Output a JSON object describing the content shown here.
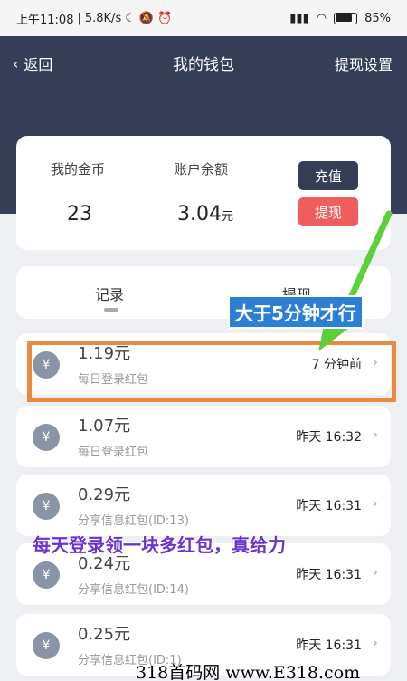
{
  "status_bar": {
    "time": "上午11:08",
    "net_speed": "5.8K/s",
    "battery": "85%"
  },
  "nav": {
    "back_label": "返回",
    "title": "我的钱包",
    "right_label": "提现设置"
  },
  "wallet": {
    "coins_label": "我的金币",
    "coins_value": "23",
    "balance_label": "账户余额",
    "balance_value": "3.04",
    "balance_unit": "元",
    "recharge_label": "充值",
    "withdraw_label": "提现"
  },
  "tabs": [
    {
      "label": "记录"
    },
    {
      "label": "提现"
    }
  ],
  "records": [
    {
      "amount": "1.19元",
      "desc": "每日登录红包",
      "time": "7 分钟前"
    },
    {
      "amount": "1.07元",
      "desc": "每日登录红包",
      "time": "昨天 16:32"
    },
    {
      "amount": "0.29元",
      "desc": "分享信息红包(ID:13)",
      "time": "昨天 16:31"
    },
    {
      "amount": "0.24元",
      "desc": "分享信息红包(ID:14)",
      "time": "昨天 16:31"
    },
    {
      "amount": "0.25元",
      "desc": "分享信息红包(ID:1)",
      "time": "昨天 16:31"
    }
  ],
  "icons": {
    "yen": "¥",
    "chevron": "›",
    "back": "‹"
  },
  "annotations": {
    "note1": "大于5分钟才行",
    "note2": "每天登录领一块多红包，真给力"
  },
  "watermark": "318首码网 www.E318.com",
  "colors": {
    "header": "#353d57",
    "withdraw": "#f05d5d",
    "highlight": "#e98a3f",
    "arrow": "#5ccf3a"
  }
}
